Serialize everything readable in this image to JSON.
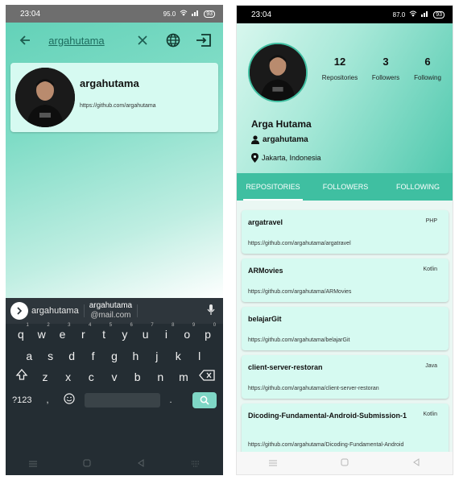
{
  "left": {
    "status": {
      "time": "23:04",
      "speed": "95.0",
      "speed_unit": "KB/S",
      "battery": "93"
    },
    "search": {
      "query": "argahutama"
    },
    "result": {
      "name": "argahutama",
      "url": "https://github.com/argahutama"
    },
    "keyboard": {
      "suggestion_1": "argahutama",
      "suggestion_2": "argahutama",
      "suggestion_2_sub": "@mail.com",
      "row1": [
        "q",
        "w",
        "e",
        "r",
        "t",
        "y",
        "u",
        "i",
        "o",
        "p"
      ],
      "row1_nums": [
        "1",
        "2",
        "3",
        "4",
        "5",
        "6",
        "7",
        "8",
        "9",
        "0"
      ],
      "row2": [
        "a",
        "s",
        "d",
        "f",
        "g",
        "h",
        "j",
        "k",
        "l"
      ],
      "row3": [
        "z",
        "x",
        "c",
        "v",
        "b",
        "n",
        "m"
      ],
      "symbols_label": "?123",
      "comma": ",",
      "period": "."
    }
  },
  "right": {
    "status": {
      "time": "23:04",
      "speed": "87.0",
      "speed_unit": "KB/S",
      "battery": "93"
    },
    "stats": [
      {
        "value": "12",
        "label": "Repositories"
      },
      {
        "value": "3",
        "label": "Followers"
      },
      {
        "value": "6",
        "label": "Following"
      }
    ],
    "name": "Arga Hutama",
    "username": "argahutama",
    "location": "Jakarta, Indonesia",
    "tabs": [
      "REPOSITORIES",
      "FOLLOWERS",
      "FOLLOWING"
    ],
    "repos": [
      {
        "name": "argatravel",
        "lang": "PHP",
        "url": "https://github.com/argahutama/argatravel"
      },
      {
        "name": "ARMovies",
        "lang": "Kotlin",
        "url": "https://github.com/argahutama/ARMovies"
      },
      {
        "name": "belajarGit",
        "lang": "",
        "url": "https://github.com/argahutama/belajarGit"
      },
      {
        "name": "client-server-restoran",
        "lang": "Java",
        "url": "https://github.com/argahutama/client-server-restoran"
      },
      {
        "name": "Dicoding-Fundamental-Android-Submission-1",
        "lang": "Kotlin",
        "url": "https://github.com/argahutama/Dicoding-Fundamental-Android"
      }
    ]
  },
  "colors": {
    "accent": "#3fbfa1",
    "card": "#d6faf1",
    "keyboard": "#242d33"
  }
}
